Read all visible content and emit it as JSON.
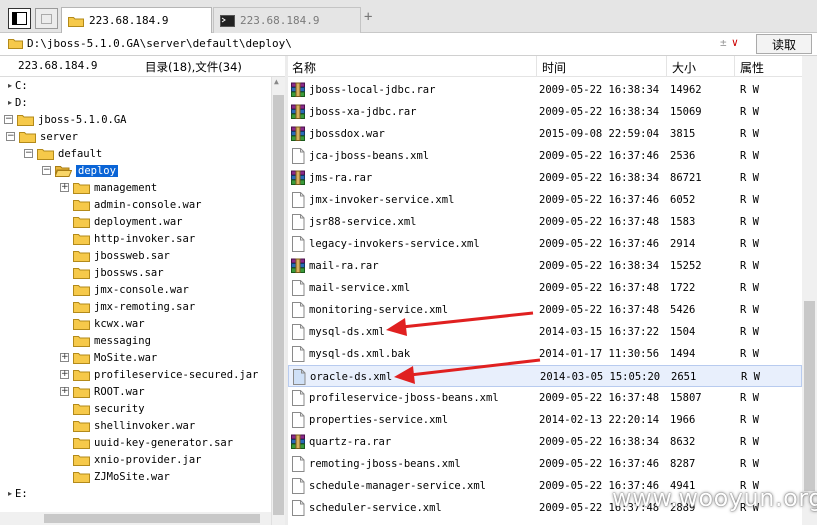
{
  "tabs": [
    {
      "label": "223.68.184.9",
      "active": true
    },
    {
      "label": "223.68.184.9",
      "active": false
    }
  ],
  "toolbar": {
    "plus_label": "+"
  },
  "path": {
    "value": "D:\\jboss-5.1.0.GA\\server\\default\\deploy\\",
    "read_label": "读取",
    "updown_icon": "±",
    "dropdown_icon": "chevron-down"
  },
  "left_header": {
    "ip": "223.68.184.9",
    "counts": "目录(18),文件(34)"
  },
  "tree": [
    {
      "label": "C:",
      "level": 0
    },
    {
      "label": "D:",
      "level": 0
    },
    {
      "label": "jboss-5.1.0.GA",
      "level": 1
    },
    {
      "label": "server",
      "level": 2
    },
    {
      "label": "default",
      "level": 3
    },
    {
      "label": "deploy",
      "level": 4
    },
    {
      "label": "management",
      "level": 5
    },
    {
      "label": "admin-console.war",
      "level": 5
    },
    {
      "label": "deployment.war",
      "level": 5
    },
    {
      "label": "http-invoker.sar",
      "level": 5
    },
    {
      "label": "jbossweb.sar",
      "level": 5
    },
    {
      "label": "jbossws.sar",
      "level": 5
    },
    {
      "label": "jmx-console.war",
      "level": 5
    },
    {
      "label": "jmx-remoting.sar",
      "level": 5
    },
    {
      "label": "kcwx.war",
      "level": 5
    },
    {
      "label": "messaging",
      "level": 5
    },
    {
      "label": "MoSite.war",
      "level": 5
    },
    {
      "label": "profileservice-secured.jar",
      "level": 5
    },
    {
      "label": "ROOT.war",
      "level": 5
    },
    {
      "label": "security",
      "level": 5
    },
    {
      "label": "shellinvoker.war",
      "level": 5
    },
    {
      "label": "uuid-key-generator.sar",
      "level": 5
    },
    {
      "label": "xnio-provider.jar",
      "level": 5
    },
    {
      "label": "ZJMoSite.war",
      "level": 5
    },
    {
      "label": "E:",
      "level": 0
    }
  ],
  "columns": {
    "name": "名称",
    "time": "时间",
    "size": "大小",
    "attr": "属性"
  },
  "files": [
    {
      "name": "jboss-local-jdbc.rar",
      "time": "2009-05-22 16:38:34",
      "size": "14962",
      "attr": "R W",
      "icon": "archive-icon"
    },
    {
      "name": "jboss-xa-jdbc.rar",
      "time": "2009-05-22 16:38:34",
      "size": "15069",
      "attr": "R W",
      "icon": "archive-icon"
    },
    {
      "name": "jbossdox.war",
      "time": "2015-09-08 22:59:04",
      "size": "3815",
      "attr": "R W",
      "icon": "archive-icon"
    },
    {
      "name": "jca-jboss-beans.xml",
      "time": "2009-05-22 16:37:46",
      "size": "2536",
      "attr": "R W",
      "icon": "document-icon"
    },
    {
      "name": "jms-ra.rar",
      "time": "2009-05-22 16:38:34",
      "size": "86721",
      "attr": "R W",
      "icon": "archive-icon"
    },
    {
      "name": "jmx-invoker-service.xml",
      "time": "2009-05-22 16:37:46",
      "size": "6052",
      "attr": "R W",
      "icon": "document-icon"
    },
    {
      "name": "jsr88-service.xml",
      "time": "2009-05-22 16:37:48",
      "size": "1583",
      "attr": "R W",
      "icon": "document-icon"
    },
    {
      "name": "legacy-invokers-service.xml",
      "time": "2009-05-22 16:37:46",
      "size": "2914",
      "attr": "R W",
      "icon": "document-icon"
    },
    {
      "name": "mail-ra.rar",
      "time": "2009-05-22 16:38:34",
      "size": "15252",
      "attr": "R W",
      "icon": "archive-icon"
    },
    {
      "name": "mail-service.xml",
      "time": "2009-05-22 16:37:48",
      "size": "1722",
      "attr": "R W",
      "icon": "document-icon"
    },
    {
      "name": "monitoring-service.xml",
      "time": "2009-05-22 16:37:48",
      "size": "5426",
      "attr": "R W",
      "icon": "document-icon"
    },
    {
      "name": "mysql-ds.xml",
      "time": "2014-03-15 16:37:22",
      "size": "1504",
      "attr": "R W",
      "icon": "document-icon"
    },
    {
      "name": "mysql-ds.xml.bak",
      "time": "2014-01-17 11:30:56",
      "size": "1494",
      "attr": "R W",
      "icon": "document-icon"
    },
    {
      "name": "oracle-ds.xml",
      "time": "2014-03-05 15:05:20",
      "size": "2651",
      "attr": "R W",
      "icon": "document-icon",
      "highlight": true
    },
    {
      "name": "profileservice-jboss-beans.xml",
      "time": "2009-05-22 16:37:48",
      "size": "15807",
      "attr": "R W",
      "icon": "document-icon"
    },
    {
      "name": "properties-service.xml",
      "time": "2014-02-13 22:20:14",
      "size": "1966",
      "attr": "R W",
      "icon": "document-icon"
    },
    {
      "name": "quartz-ra.rar",
      "time": "2009-05-22 16:38:34",
      "size": "8632",
      "attr": "R W",
      "icon": "archive-icon"
    },
    {
      "name": "remoting-jboss-beans.xml",
      "time": "2009-05-22 16:37:46",
      "size": "8287",
      "attr": "R W",
      "icon": "document-icon"
    },
    {
      "name": "schedule-manager-service.xml",
      "time": "2009-05-22 16:37:46",
      "size": "4941",
      "attr": "R W",
      "icon": "document-icon"
    },
    {
      "name": "scheduler-service.xml",
      "time": "2009-05-22 16:37:48",
      "size": "2889",
      "attr": "R W",
      "icon": "document-icon"
    }
  ],
  "watermark": "www.wooyun.org",
  "colors": {
    "selection": "#0a64d6",
    "highlight_row": "#e8effc",
    "arrow": "#e02020",
    "folder": "#f6c94a"
  }
}
